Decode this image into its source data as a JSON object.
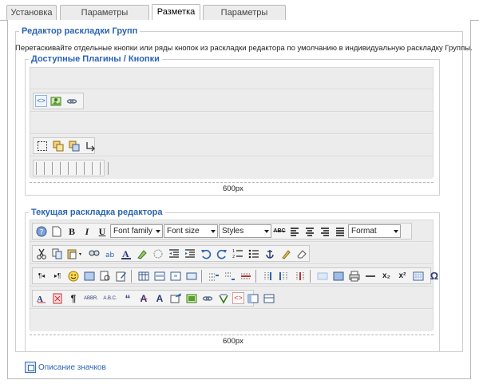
{
  "tabs": [
    {
      "label": "Установка"
    },
    {
      "label": "Параметры Редактора"
    },
    {
      "label": "Разметка",
      "active": true
    },
    {
      "label": "Параметры плагина"
    }
  ],
  "group_layout": {
    "title": "Редактор раскладки Групп",
    "description": "Перетаскивайте отдельные кнопки или ряды кнопок из раскладки редактора по умолчанию в индивидуальную раскладку Группы."
  },
  "available": {
    "title": "Доступные Плагины / Кнопки",
    "width_label": "600px",
    "rows": [
      {
        "icons": []
      },
      {
        "icons": [
          "code-view-icon",
          "image-manager-icon",
          "link-icon"
        ]
      },
      {
        "icons": []
      },
      {
        "icons": [
          "select-all-icon",
          "copy-cells-icon",
          "paste-cells-icon",
          "anchor-corner-icon"
        ]
      },
      {
        "icons": [
          "separator",
          "separator",
          "separator",
          "separator",
          "separator",
          "separator",
          "separator",
          "separator",
          "separator",
          "separator"
        ]
      }
    ]
  },
  "current": {
    "title": "Текущая раскладка редактора",
    "width_label": "600px",
    "selects": {
      "font_family": "Font family",
      "font_size": "Font size",
      "styles": "Styles",
      "format": "Format"
    },
    "text_buttons": {
      "bold": "B",
      "italic": "I",
      "underline": "U",
      "strike": "ABC",
      "help_glyph": "?",
      "omega": "Ω",
      "paragraph": "¶",
      "sub": "x₂",
      "sup": "x²",
      "ltr": "¶◂",
      "rtl": "▸¶",
      "abbr": "ABBR.",
      "acronym": "A.B.C.",
      "cite": "“",
      "del": "A",
      "ins": "A"
    }
  },
  "footer": {
    "link": "Описание значков"
  },
  "colors": {
    "accent": "#2b64b3",
    "row_bg": "#ececec",
    "border": "#b9b9b9"
  }
}
